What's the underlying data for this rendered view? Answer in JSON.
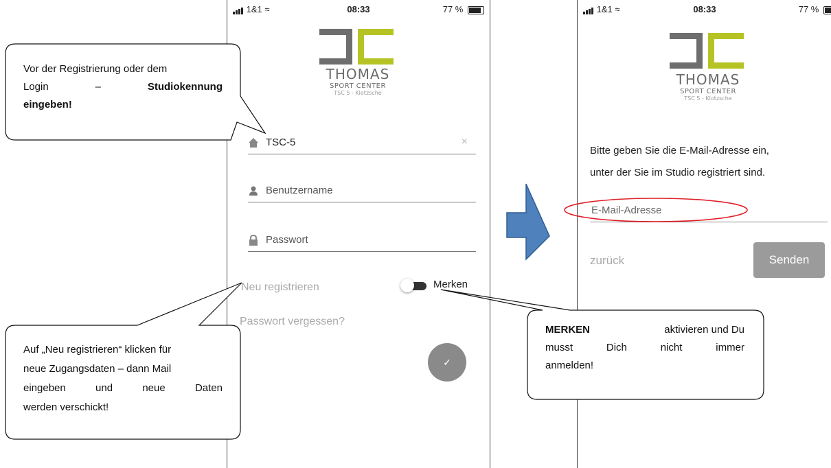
{
  "left_phone": {
    "status": {
      "carrier": "1&1",
      "time": "08:33",
      "battery": "77 %"
    },
    "logo": {
      "line1": "THOMAS",
      "line2": "SPORT CENTER",
      "line3": "TSC 5 - Klotzsche"
    },
    "studio_field": {
      "value": "TSC-5",
      "clear_glyph": "×"
    },
    "username_field": {
      "placeholder": "Benutzername"
    },
    "password_field": {
      "placeholder": "Passwort"
    },
    "register_link": "Neu registrieren",
    "remember_label": "Merken",
    "forgot_link": "Passwort vergessen?",
    "submit_glyph": "✓"
  },
  "right_phone": {
    "status": {
      "carrier": "1&1",
      "time": "08:33",
      "battery": "77 %"
    },
    "logo": {
      "line1": "THOMAS",
      "line2": "SPORT CENTER",
      "line3": "TSC 5 - Klotzsche"
    },
    "instruction_line1": "Bitte geben Sie die E-Mail-Adresse ein,",
    "instruction_line2": "unter der Sie im Studio registriert sind.",
    "email_placeholder": "E-Mail-Adresse",
    "back_link": "zurück",
    "send_button": "Senden"
  },
  "callouts": {
    "top_left": {
      "line1": "Vor der Registrierung oder dem",
      "line2_a": "Login",
      "line2_b": "–",
      "line2_c": "Studiokennung",
      "line3": "eingeben!"
    },
    "bottom_left": {
      "line1": "Auf „Neu registrieren“ klicken für",
      "line2": "neue Zugangsdaten – dann Mail",
      "line3": "eingeben und neue Daten",
      "line4": "werden verschickt!"
    },
    "right": {
      "line1_bold": "MERKEN",
      "line1_rest": "aktivieren und Du",
      "line2_a": "musst",
      "line2_b": "Dich",
      "line2_c": "nicht",
      "line2_d": "immer",
      "line3": "anmelden!"
    }
  },
  "colors": {
    "logo_green": "#b5c424",
    "logo_gray": "#6e6e6e",
    "arrow_blue": "#4f81bd",
    "highlight_red": "#e0202a"
  }
}
